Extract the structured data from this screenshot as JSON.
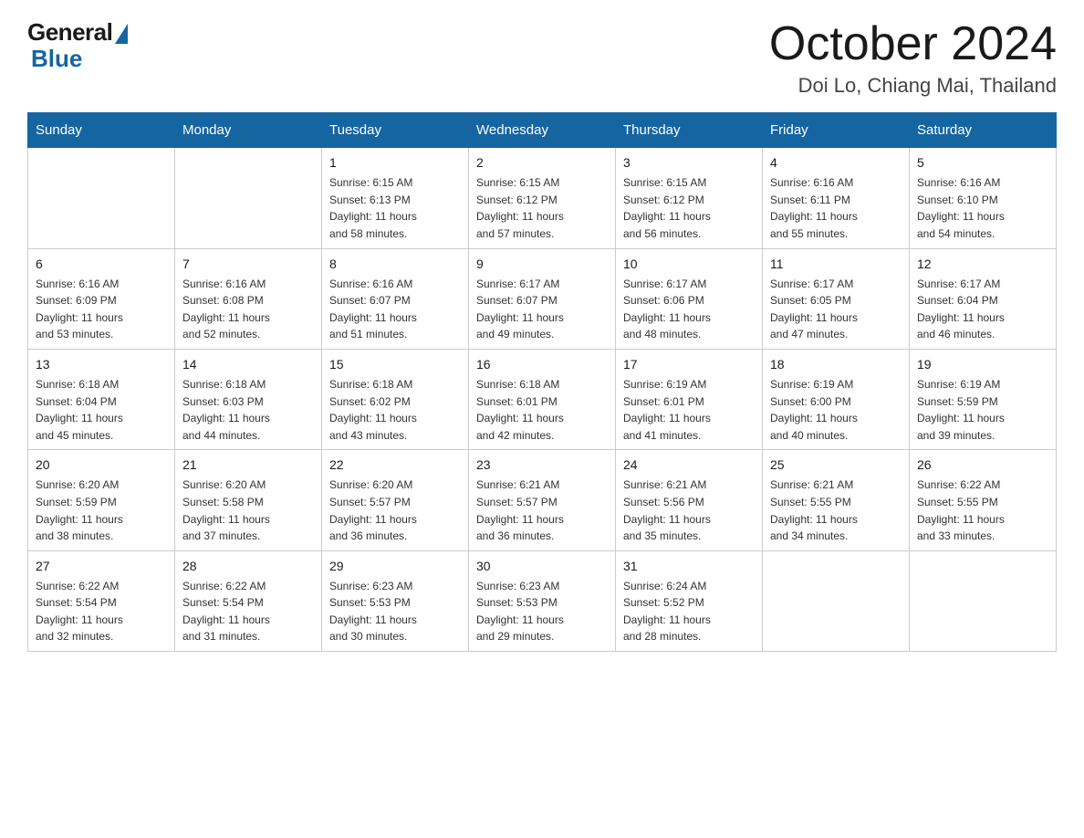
{
  "logo": {
    "general": "General",
    "blue": "Blue"
  },
  "title": "October 2024",
  "location": "Doi Lo, Chiang Mai, Thailand",
  "headers": [
    "Sunday",
    "Monday",
    "Tuesday",
    "Wednesday",
    "Thursday",
    "Friday",
    "Saturday"
  ],
  "weeks": [
    [
      {
        "day": "",
        "info": ""
      },
      {
        "day": "",
        "info": ""
      },
      {
        "day": "1",
        "info": "Sunrise: 6:15 AM\nSunset: 6:13 PM\nDaylight: 11 hours\nand 58 minutes."
      },
      {
        "day": "2",
        "info": "Sunrise: 6:15 AM\nSunset: 6:12 PM\nDaylight: 11 hours\nand 57 minutes."
      },
      {
        "day": "3",
        "info": "Sunrise: 6:15 AM\nSunset: 6:12 PM\nDaylight: 11 hours\nand 56 minutes."
      },
      {
        "day": "4",
        "info": "Sunrise: 6:16 AM\nSunset: 6:11 PM\nDaylight: 11 hours\nand 55 minutes."
      },
      {
        "day": "5",
        "info": "Sunrise: 6:16 AM\nSunset: 6:10 PM\nDaylight: 11 hours\nand 54 minutes."
      }
    ],
    [
      {
        "day": "6",
        "info": "Sunrise: 6:16 AM\nSunset: 6:09 PM\nDaylight: 11 hours\nand 53 minutes."
      },
      {
        "day": "7",
        "info": "Sunrise: 6:16 AM\nSunset: 6:08 PM\nDaylight: 11 hours\nand 52 minutes."
      },
      {
        "day": "8",
        "info": "Sunrise: 6:16 AM\nSunset: 6:07 PM\nDaylight: 11 hours\nand 51 minutes."
      },
      {
        "day": "9",
        "info": "Sunrise: 6:17 AM\nSunset: 6:07 PM\nDaylight: 11 hours\nand 49 minutes."
      },
      {
        "day": "10",
        "info": "Sunrise: 6:17 AM\nSunset: 6:06 PM\nDaylight: 11 hours\nand 48 minutes."
      },
      {
        "day": "11",
        "info": "Sunrise: 6:17 AM\nSunset: 6:05 PM\nDaylight: 11 hours\nand 47 minutes."
      },
      {
        "day": "12",
        "info": "Sunrise: 6:17 AM\nSunset: 6:04 PM\nDaylight: 11 hours\nand 46 minutes."
      }
    ],
    [
      {
        "day": "13",
        "info": "Sunrise: 6:18 AM\nSunset: 6:04 PM\nDaylight: 11 hours\nand 45 minutes."
      },
      {
        "day": "14",
        "info": "Sunrise: 6:18 AM\nSunset: 6:03 PM\nDaylight: 11 hours\nand 44 minutes."
      },
      {
        "day": "15",
        "info": "Sunrise: 6:18 AM\nSunset: 6:02 PM\nDaylight: 11 hours\nand 43 minutes."
      },
      {
        "day": "16",
        "info": "Sunrise: 6:18 AM\nSunset: 6:01 PM\nDaylight: 11 hours\nand 42 minutes."
      },
      {
        "day": "17",
        "info": "Sunrise: 6:19 AM\nSunset: 6:01 PM\nDaylight: 11 hours\nand 41 minutes."
      },
      {
        "day": "18",
        "info": "Sunrise: 6:19 AM\nSunset: 6:00 PM\nDaylight: 11 hours\nand 40 minutes."
      },
      {
        "day": "19",
        "info": "Sunrise: 6:19 AM\nSunset: 5:59 PM\nDaylight: 11 hours\nand 39 minutes."
      }
    ],
    [
      {
        "day": "20",
        "info": "Sunrise: 6:20 AM\nSunset: 5:59 PM\nDaylight: 11 hours\nand 38 minutes."
      },
      {
        "day": "21",
        "info": "Sunrise: 6:20 AM\nSunset: 5:58 PM\nDaylight: 11 hours\nand 37 minutes."
      },
      {
        "day": "22",
        "info": "Sunrise: 6:20 AM\nSunset: 5:57 PM\nDaylight: 11 hours\nand 36 minutes."
      },
      {
        "day": "23",
        "info": "Sunrise: 6:21 AM\nSunset: 5:57 PM\nDaylight: 11 hours\nand 36 minutes."
      },
      {
        "day": "24",
        "info": "Sunrise: 6:21 AM\nSunset: 5:56 PM\nDaylight: 11 hours\nand 35 minutes."
      },
      {
        "day": "25",
        "info": "Sunrise: 6:21 AM\nSunset: 5:55 PM\nDaylight: 11 hours\nand 34 minutes."
      },
      {
        "day": "26",
        "info": "Sunrise: 6:22 AM\nSunset: 5:55 PM\nDaylight: 11 hours\nand 33 minutes."
      }
    ],
    [
      {
        "day": "27",
        "info": "Sunrise: 6:22 AM\nSunset: 5:54 PM\nDaylight: 11 hours\nand 32 minutes."
      },
      {
        "day": "28",
        "info": "Sunrise: 6:22 AM\nSunset: 5:54 PM\nDaylight: 11 hours\nand 31 minutes."
      },
      {
        "day": "29",
        "info": "Sunrise: 6:23 AM\nSunset: 5:53 PM\nDaylight: 11 hours\nand 30 minutes."
      },
      {
        "day": "30",
        "info": "Sunrise: 6:23 AM\nSunset: 5:53 PM\nDaylight: 11 hours\nand 29 minutes."
      },
      {
        "day": "31",
        "info": "Sunrise: 6:24 AM\nSunset: 5:52 PM\nDaylight: 11 hours\nand 28 minutes."
      },
      {
        "day": "",
        "info": ""
      },
      {
        "day": "",
        "info": ""
      }
    ]
  ]
}
